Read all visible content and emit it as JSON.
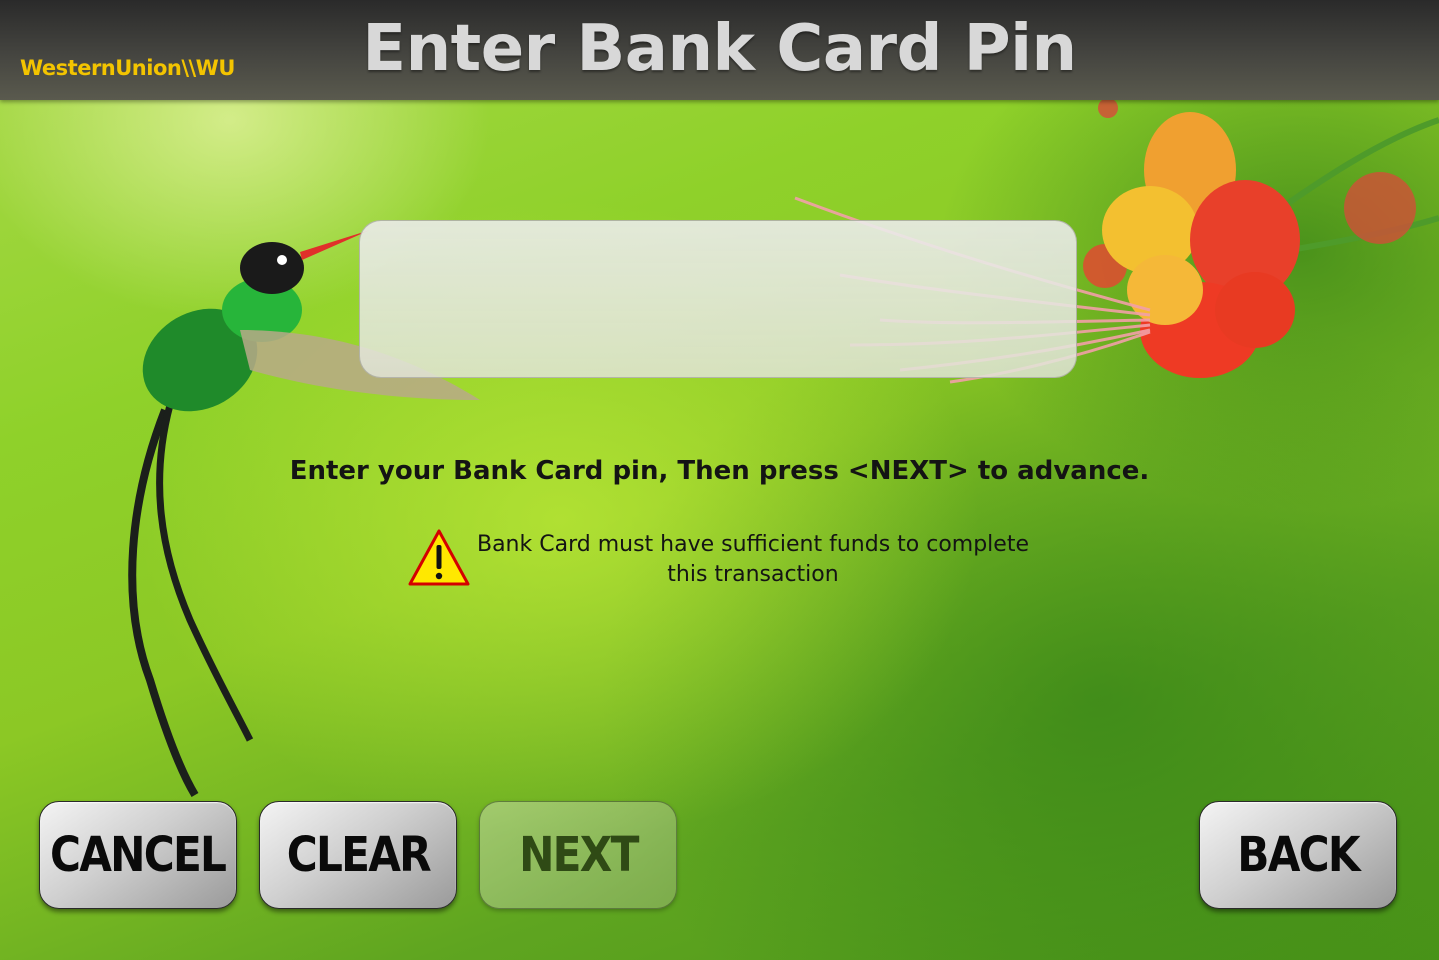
{
  "header": {
    "logo_text": "WesternUnion\\\\WU",
    "title": "Enter Bank Card Pin"
  },
  "pin_input": {
    "value": "",
    "placeholder": ""
  },
  "instruction": "Enter your Bank Card pin, Then press <NEXT> to advance.",
  "warning": {
    "icon": "warning-triangle-icon",
    "line1": "Bank Card must have sufficient funds to complete",
    "line2": "this transaction"
  },
  "buttons": {
    "cancel": "CANCEL",
    "clear": "CLEAR",
    "next": "NEXT",
    "back": "BACK"
  },
  "colors": {
    "logo": "#f3c400",
    "header_bg": "#3a3a36",
    "warning_fill": "#ffe800",
    "warning_stroke": "#d40000"
  }
}
